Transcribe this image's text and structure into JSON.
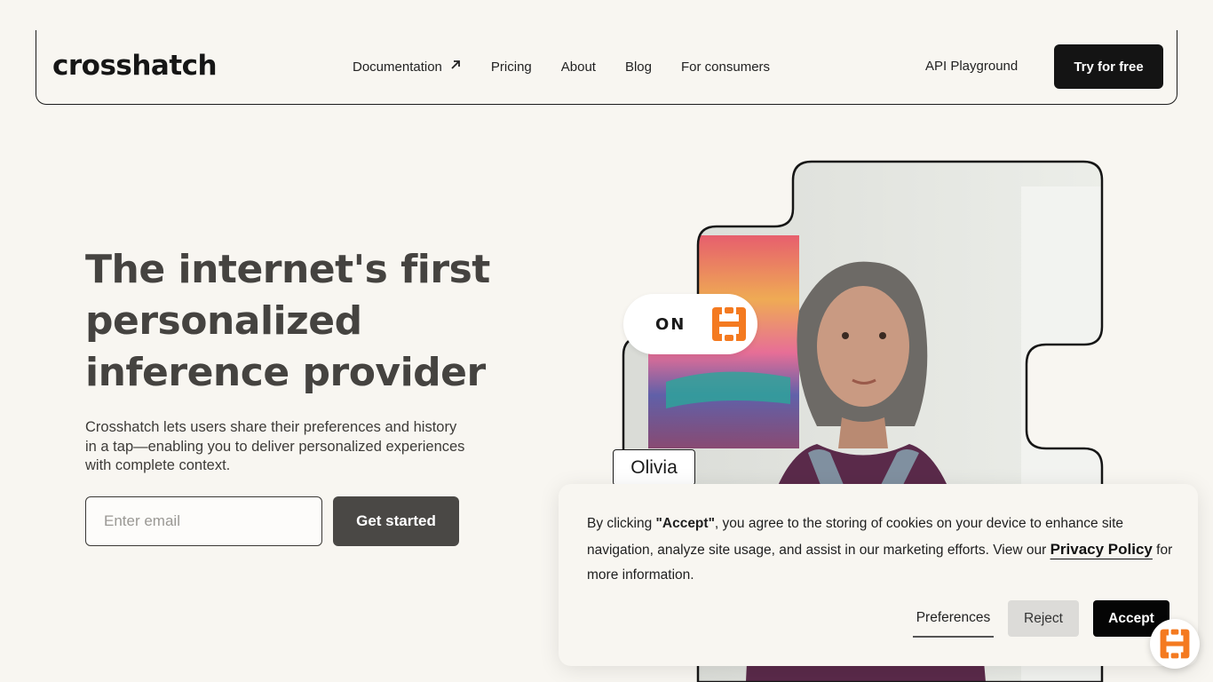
{
  "nav": {
    "logo": "crosshatch",
    "links": [
      {
        "label": "Documentation",
        "icon": "arrow-up-right-icon"
      },
      {
        "label": "Pricing"
      },
      {
        "label": "About"
      },
      {
        "label": "Blog"
      },
      {
        "label": "For consumers"
      }
    ],
    "api_label": "API Playground",
    "cta_label": "Try for free"
  },
  "hero": {
    "title": "The internet's first personalized inference provider",
    "description": "Crosshatch lets users share their preferences and history in a tap—enabling you to deliver personalized experiences with complete context.",
    "email_placeholder": "Enter email",
    "email_value": "",
    "cta_label": "Get started",
    "badge_label": "ON",
    "person_name": "Olivia"
  },
  "cookie": {
    "text_prefix": "By clicking ",
    "text_bold": "\"Accept\"",
    "text_middle": ", you agree to the storing of cookies on your device to enhance site navigation, analyze site usage, and assist in our marketing efforts. View our ",
    "privacy_link": "Privacy Policy",
    "text_suffix": " for more information.",
    "preferences_label": "Preferences",
    "reject_label": "Reject",
    "accept_label": "Accept"
  },
  "colors": {
    "background": "#f8f6f1",
    "brand_orange": "#f47a20",
    "dark": "#141414"
  }
}
